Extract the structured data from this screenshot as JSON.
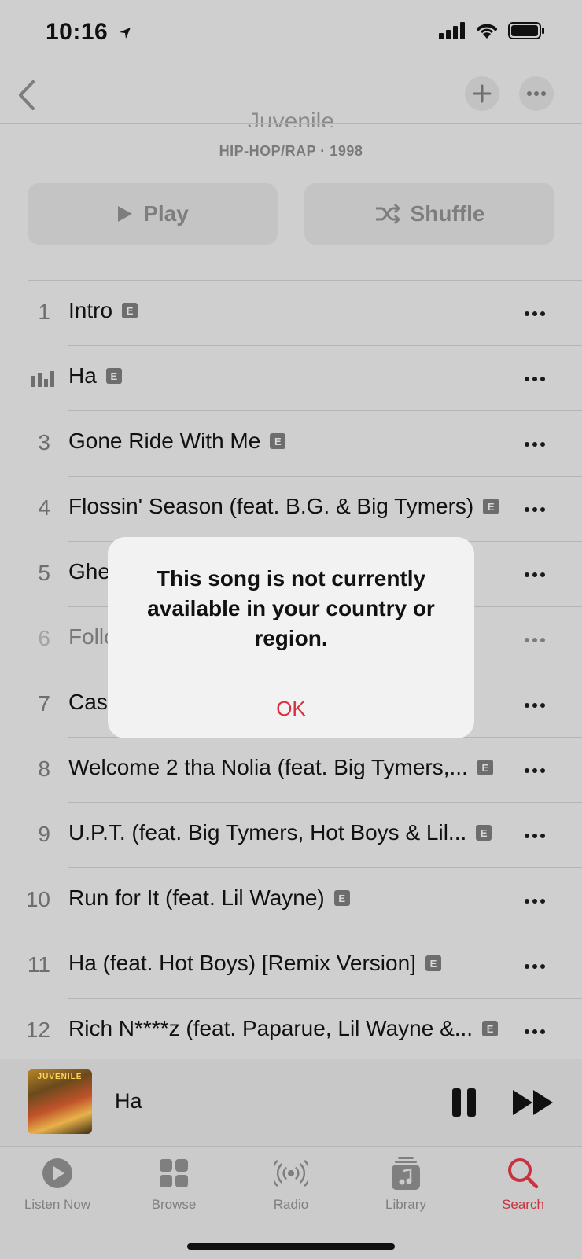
{
  "status_bar": {
    "time": "10:16"
  },
  "album": {
    "artist_peek": "Juvenile",
    "meta": "HIP-HOP/RAP · 1998"
  },
  "buttons": {
    "play": "Play",
    "shuffle": "Shuffle"
  },
  "explicit_badge": "E",
  "tracks": [
    {
      "num": "1",
      "title": "Intro",
      "explicit": true
    },
    {
      "num": "",
      "title": "Ha",
      "explicit": true,
      "now_playing": true
    },
    {
      "num": "3",
      "title": "Gone Ride With Me",
      "explicit": true
    },
    {
      "num": "4",
      "title": "Flossin' Season (feat. B.G. & Big Tymers)",
      "explicit": true
    },
    {
      "num": "5",
      "title": "Ghe",
      "explicit": false
    },
    {
      "num": "6",
      "title": "Follo",
      "explicit": false,
      "dimmed": true
    },
    {
      "num": "7",
      "title": "Cas",
      "explicit": false
    },
    {
      "num": "8",
      "title": "Welcome 2 tha Nolia (feat. Big Tymers,...",
      "explicit": true
    },
    {
      "num": "9",
      "title": "U.P.T. (feat. Big Tymers, Hot Boys & Lil...",
      "explicit": true
    },
    {
      "num": "10",
      "title": "Run for It (feat. Lil Wayne)",
      "explicit": true
    },
    {
      "num": "11",
      "title": "Ha (feat. Hot Boys) [Remix Version]",
      "explicit": true
    },
    {
      "num": "12",
      "title": "Rich N****z (feat. Paparue, Lil Wayne &...",
      "explicit": true
    }
  ],
  "alert": {
    "message": "This song is not currently available in your country or region.",
    "ok": "OK"
  },
  "mini_player": {
    "title": "Ha",
    "art_text": "JUVENILE"
  },
  "tabs": [
    {
      "label": "Listen Now",
      "icon": "play-circle-icon"
    },
    {
      "label": "Browse",
      "icon": "grid-icon"
    },
    {
      "label": "Radio",
      "icon": "radio-icon"
    },
    {
      "label": "Library",
      "icon": "library-icon"
    },
    {
      "label": "Search",
      "icon": "search-icon",
      "active": true
    }
  ],
  "colors": {
    "accent": "#d9303e",
    "background": "#cfcfcf"
  }
}
